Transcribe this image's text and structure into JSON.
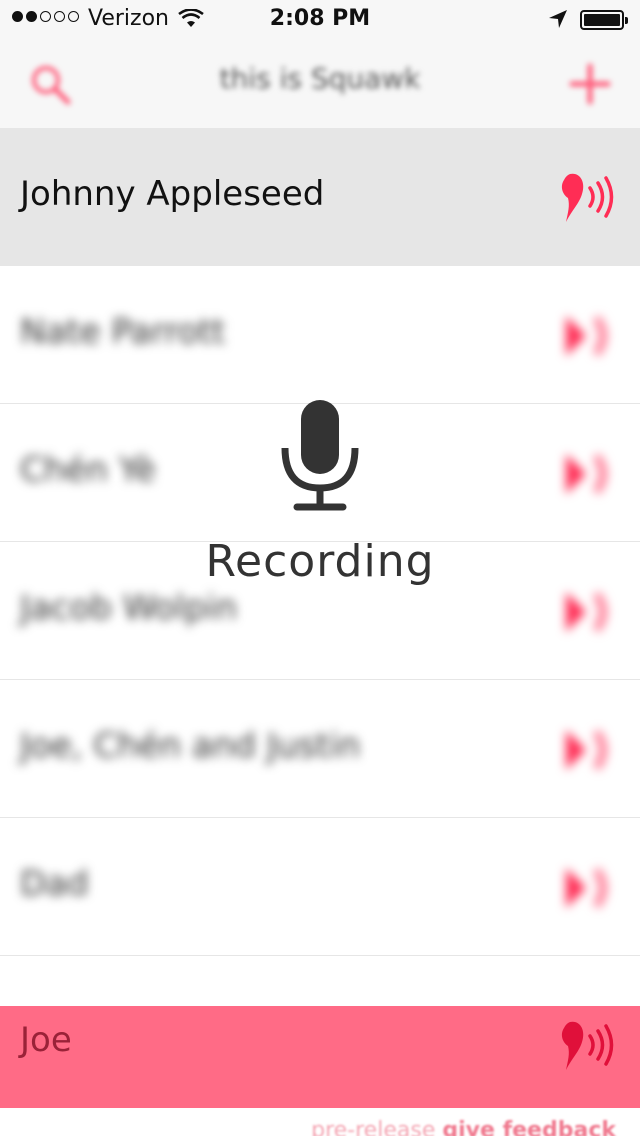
{
  "status_bar": {
    "carrier": "Verizon",
    "time": "2:08 PM",
    "signal_filled": 2,
    "signal_total": 5
  },
  "nav": {
    "title": "this is Squawk",
    "search_icon": "search-icon",
    "add_icon": "plus-icon"
  },
  "contacts": [
    {
      "name": "Johnny Appleseed"
    },
    {
      "name": "Nate Parrott"
    },
    {
      "name": "Chén Yè"
    },
    {
      "name": "Jacob Wolpin"
    },
    {
      "name": "Joe, Chén and Justin"
    },
    {
      "name": "Dad"
    }
  ],
  "bottom_contact": {
    "name": "Joe"
  },
  "overlay": {
    "label": "Recording",
    "icon": "microphone-icon"
  },
  "footer": {
    "prefix": "pre-release",
    "link": "give feedback"
  },
  "colors": {
    "accent": "#ff2d55",
    "bottom_row": "#ff6b86",
    "highlight_row": "#e6e6e6"
  }
}
